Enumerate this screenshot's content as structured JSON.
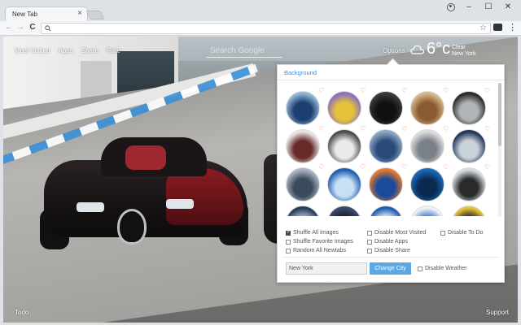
{
  "browser": {
    "tab_title": "New Tab",
    "tab_close": "×",
    "window_controls": {
      "minimize": "–",
      "maximize": "☐",
      "close": "✕"
    },
    "nav": {
      "back": "←",
      "forward": "→",
      "reload": "C"
    },
    "omnibox": {
      "value": "",
      "placeholder": ""
    },
    "bookmark_star": "☆",
    "menu": "⋮",
    "icons": [
      "profile-icon",
      "search-icon",
      "star-icon",
      "extension-icon",
      "menu-icon"
    ]
  },
  "page": {
    "topnav": [
      "Most Visited",
      "Apps",
      "Share",
      "Rate"
    ],
    "search_placeholder": "Search Google",
    "options_label": "Options",
    "weather": {
      "temp": "6°c",
      "condition": "Clear",
      "city": "New York",
      "icon": "cloud-icon"
    },
    "bottom_left": "Todo",
    "bottom_right": "Support"
  },
  "options_panel": {
    "tab_label": "Background",
    "thumbnails": [
      {
        "colors": [
          "#8fb6d8",
          "#1d3e70"
        ],
        "favorite": true
      },
      {
        "colors": [
          "#8a6fc0",
          "#e6c23a"
        ],
        "favorite": true
      },
      {
        "colors": [
          "#3a3a3a",
          "#101010"
        ],
        "favorite": true
      },
      {
        "colors": [
          "#d8b58a",
          "#8a5a30"
        ],
        "favorite": true
      },
      {
        "colors": [
          "#2a2a2a",
          "#aeb4b8"
        ],
        "favorite": true
      },
      {
        "colors": [
          "#e6e6e6",
          "#6a2a2a"
        ],
        "favorite": true
      },
      {
        "colors": [
          "#4a4a4a",
          "#eaeaea"
        ],
        "favorite": true
      },
      {
        "colors": [
          "#8aa7c4",
          "#2a4a7a"
        ],
        "favorite": true
      },
      {
        "colors": [
          "#dcdcdc",
          "#7a8088"
        ],
        "favorite": true
      },
      {
        "colors": [
          "#20345a",
          "#c9d2da"
        ],
        "favorite": true
      },
      {
        "colors": [
          "#aab4c2",
          "#3a4a5a"
        ],
        "favorite": true
      },
      {
        "colors": [
          "#1e5cb0",
          "#c8e0f4"
        ],
        "favorite": true
      },
      {
        "colors": [
          "#e87a2a",
          "#1a4a9a"
        ],
        "favorite": true
      },
      {
        "colors": [
          "#1a6ab8",
          "#0b2a52"
        ],
        "favorite": true
      },
      {
        "colors": [
          "#d8dde2",
          "#2a2a2a"
        ],
        "favorite": true
      },
      {
        "colors": [
          "#2a3a5a",
          "#a8b8c8"
        ],
        "favorite": false
      },
      {
        "colors": [
          "#3a4a6a",
          "#1a1a2a"
        ],
        "favorite": false
      },
      {
        "colors": [
          "#1e5cb0",
          "#e6eef6"
        ],
        "favorite": false
      },
      {
        "colors": [
          "#f0f4f8",
          "#3a7ac8"
        ],
        "favorite": false
      },
      {
        "colors": [
          "#e6c23a",
          "#2a2a2a"
        ],
        "favorite": false
      }
    ],
    "checkboxes": [
      {
        "label": "Shuffle All Images",
        "checked": true
      },
      {
        "label": "Shuffle Favorite Images",
        "checked": false
      },
      {
        "label": "Random All Newtabs",
        "checked": false
      },
      {
        "label": "Disable Most Visited",
        "checked": false
      },
      {
        "label": "Disable Apps",
        "checked": false
      },
      {
        "label": "Disable Share",
        "checked": false
      },
      {
        "label": "Disable To Do",
        "checked": false
      }
    ],
    "city_input_value": "New York",
    "change_city_label": "Change City",
    "disable_weather_label": "Disable Weather",
    "heart_glyph": "♡",
    "accent_color": "#3b8ed8",
    "button_color": "#5aa9e6"
  }
}
